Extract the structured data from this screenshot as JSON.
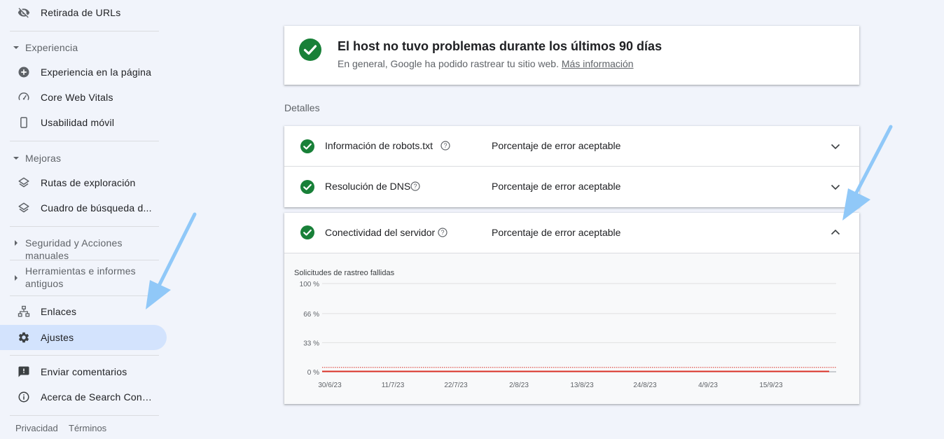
{
  "sidebar": {
    "items": [
      {
        "label": "Retirada de URLs",
        "icon": "eye-off-icon"
      },
      {
        "label": "Experiencia en la página",
        "icon": "add-circle-icon"
      },
      {
        "label": "Core Web Vitals",
        "icon": "speed-gauge-icon"
      },
      {
        "label": "Usabilidad móvil",
        "icon": "smartphone-icon"
      },
      {
        "label": "Rutas de exploración",
        "icon": "layers-icon"
      },
      {
        "label": "Cuadro de búsqueda d...",
        "icon": "layers-icon"
      },
      {
        "label": "Enlaces",
        "icon": "sitemap-icon"
      },
      {
        "label": "Ajustes",
        "icon": "gear-icon"
      },
      {
        "label": "Enviar comentarios",
        "icon": "feedback-icon"
      },
      {
        "label": "Acerca de Search Cons...",
        "icon": "info-icon"
      }
    ],
    "sections": {
      "experiencia": "Experiencia",
      "mejoras": "Mejoras",
      "seguridad": "Seguridad y Acciones manuales",
      "herramientas_line1": "Herramientas e informes",
      "herramientas_line2": "antiguos"
    },
    "footer": {
      "privacidad": "Privacidad",
      "terminos": "Términos"
    }
  },
  "host_card": {
    "title": "El host no tuvo problemas durante los últimos 90 días",
    "subtitle": "En general, Google ha podido rastrear tu sitio web.",
    "link": "Más información"
  },
  "details_label": "Detalles",
  "rows": [
    {
      "name": "Información de robots.txt",
      "status": "Porcentaje de error aceptable"
    },
    {
      "name": "Resolución de DNS",
      "status": "Porcentaje de error aceptable"
    },
    {
      "name": "Conectividad del servidor",
      "status": "Porcentaje de error aceptable"
    }
  ],
  "colors": {
    "success": "#188038",
    "accent": "#d3e3fd",
    "error_line": "#d93025",
    "annotation_arrow": "#90c8f8"
  },
  "chart_data": {
    "type": "line",
    "title": "Solicitudes de rastreo fallidas",
    "y_tick_labels": [
      "100 %",
      "66 %",
      "33 %",
      "0 %"
    ],
    "y_ticks": [
      100,
      66,
      33,
      0
    ],
    "ylim": [
      0,
      100
    ],
    "x_tick_labels": [
      "30/6/23",
      "11/7/23",
      "22/7/23",
      "2/8/23",
      "13/8/23",
      "24/8/23",
      "4/9/23",
      "15/9/23"
    ],
    "series": [
      {
        "values": [
          0,
          0,
          0,
          0,
          0,
          0,
          0,
          0,
          0
        ]
      }
    ],
    "threshold": {
      "value": 5,
      "style": "dotted"
    },
    "grid": true
  }
}
